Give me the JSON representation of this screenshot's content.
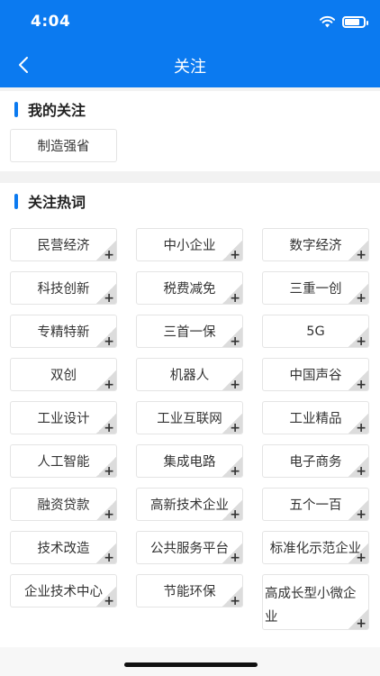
{
  "status_bar": {
    "time": "4:04"
  },
  "nav": {
    "title": "关注"
  },
  "my_follow": {
    "title": "我的关注",
    "tags": [
      "制造强省"
    ]
  },
  "hot_words": {
    "title": "关注热词",
    "tags": [
      "民营经济",
      "中小企业",
      "数字经济",
      "科技创新",
      "税费减免",
      "三重一创",
      "专精特新",
      "三首一保",
      "5G",
      "双创",
      "机器人",
      "中国声谷",
      "工业设计",
      "工业互联网",
      "工业精品",
      "人工智能",
      "集成电路",
      "电子商务",
      "融资贷款",
      "高新技术企业",
      "五个一百",
      "技术改造",
      "公共服务平台",
      "标准化示范企业",
      "企业技术中心",
      "节能环保",
      "高成长型小微企业"
    ]
  },
  "colors": {
    "accent": "#0b7af0"
  }
}
